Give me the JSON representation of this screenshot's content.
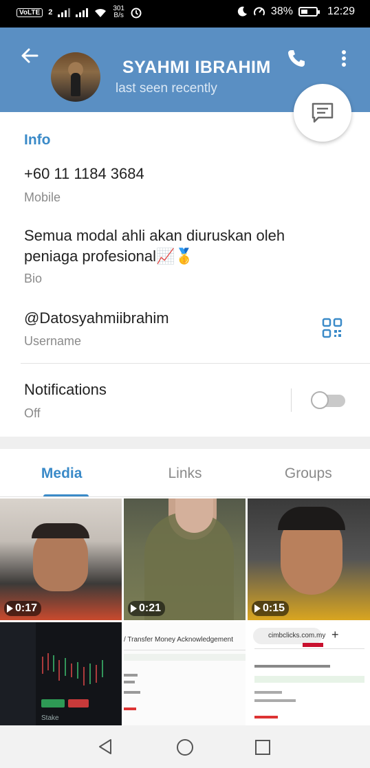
{
  "status_bar": {
    "volte": "VoLTE",
    "sim": "2",
    "speed_value": "301",
    "speed_unit": "B/s",
    "battery_percent": "38%",
    "time": "12:29"
  },
  "header": {
    "name": "SYAHMI IBRAHIM",
    "status": "last seen recently"
  },
  "info": {
    "title": "Info",
    "phone": "+60 11 1184 3684",
    "phone_label": "Mobile",
    "bio_line1": "Semua modal ahli akan diuruskan oleh",
    "bio_line2": "peniaga profesional📈🥇",
    "bio_label": "Bio",
    "username": "@Datosyahmiibrahim",
    "username_label": "Username"
  },
  "notifications": {
    "title": "Notifications",
    "state": "Off",
    "enabled": false
  },
  "tabs": [
    {
      "label": "Media",
      "active": true
    },
    {
      "label": "Links",
      "active": false
    },
    {
      "label": "Groups",
      "active": false
    }
  ],
  "media": [
    {
      "duration": "0:17"
    },
    {
      "duration": "0:21"
    },
    {
      "duration": "0:15"
    },
    {
      "caption": "Stake"
    },
    {
      "caption": "/ Transfer Money Acknowledgement"
    },
    {
      "url": "cimbclicks.com.my"
    }
  ],
  "colors": {
    "header": "#5a8fc3",
    "accent": "#3a8ac8"
  }
}
